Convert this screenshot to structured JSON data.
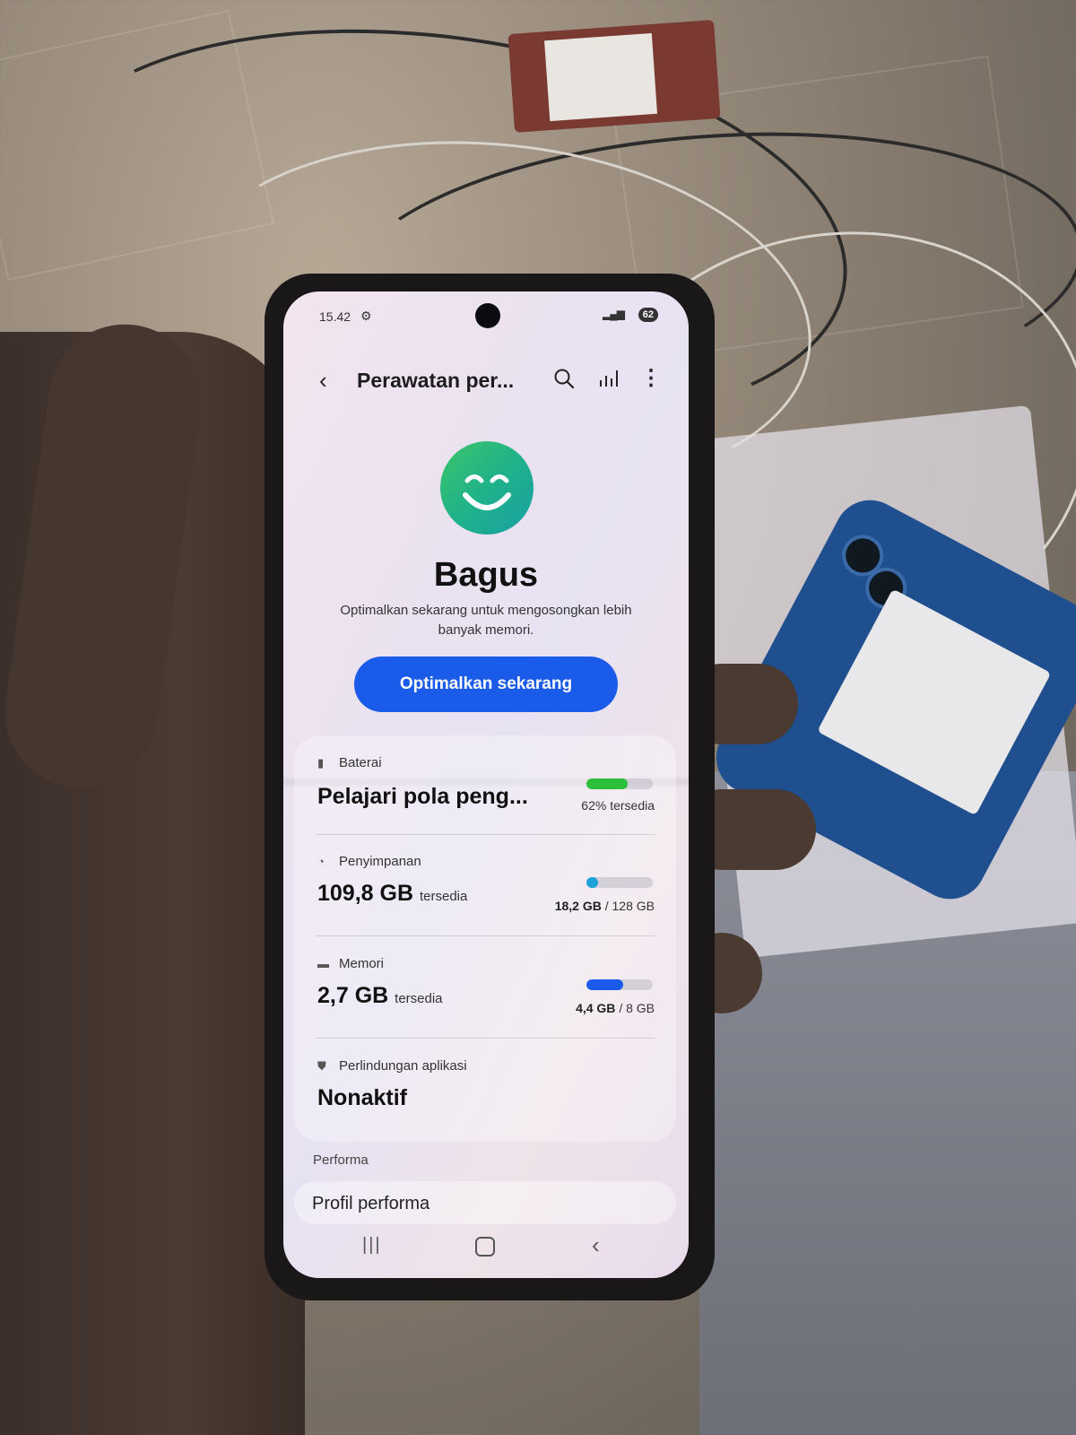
{
  "status_bar": {
    "time": "15.42",
    "battery": "62"
  },
  "app_bar": {
    "title": "Perawatan per..."
  },
  "summary": {
    "status": "Bagus",
    "description": "Optimalkan sekarang untuk mengosongkan lebih banyak memori.",
    "button_label": "Optimalkan sekarang"
  },
  "battery": {
    "heading": "Baterai",
    "value": "Pelajari pola peng...",
    "meta": "62% tersedia",
    "level": 0.62,
    "color": "#2bbf3a"
  },
  "storage": {
    "heading": "Penyimpanan",
    "value": "109,8 GB",
    "value_suffix": "tersedia",
    "used": "18,2 GB",
    "total": "/ 128 GB",
    "level": 0.142,
    "color": "#1ea0d8"
  },
  "memory": {
    "heading": "Memori",
    "value": "2,7 GB",
    "value_suffix": "tersedia",
    "used": "4,4 GB",
    "total": "/ 8 GB",
    "level": 0.55,
    "color": "#1a5bea"
  },
  "app_protection": {
    "heading": "Perlindungan aplikasi",
    "value": "Nonaktif"
  },
  "performance": {
    "section_label": "Performa",
    "profile_label": "Profil performa"
  }
}
